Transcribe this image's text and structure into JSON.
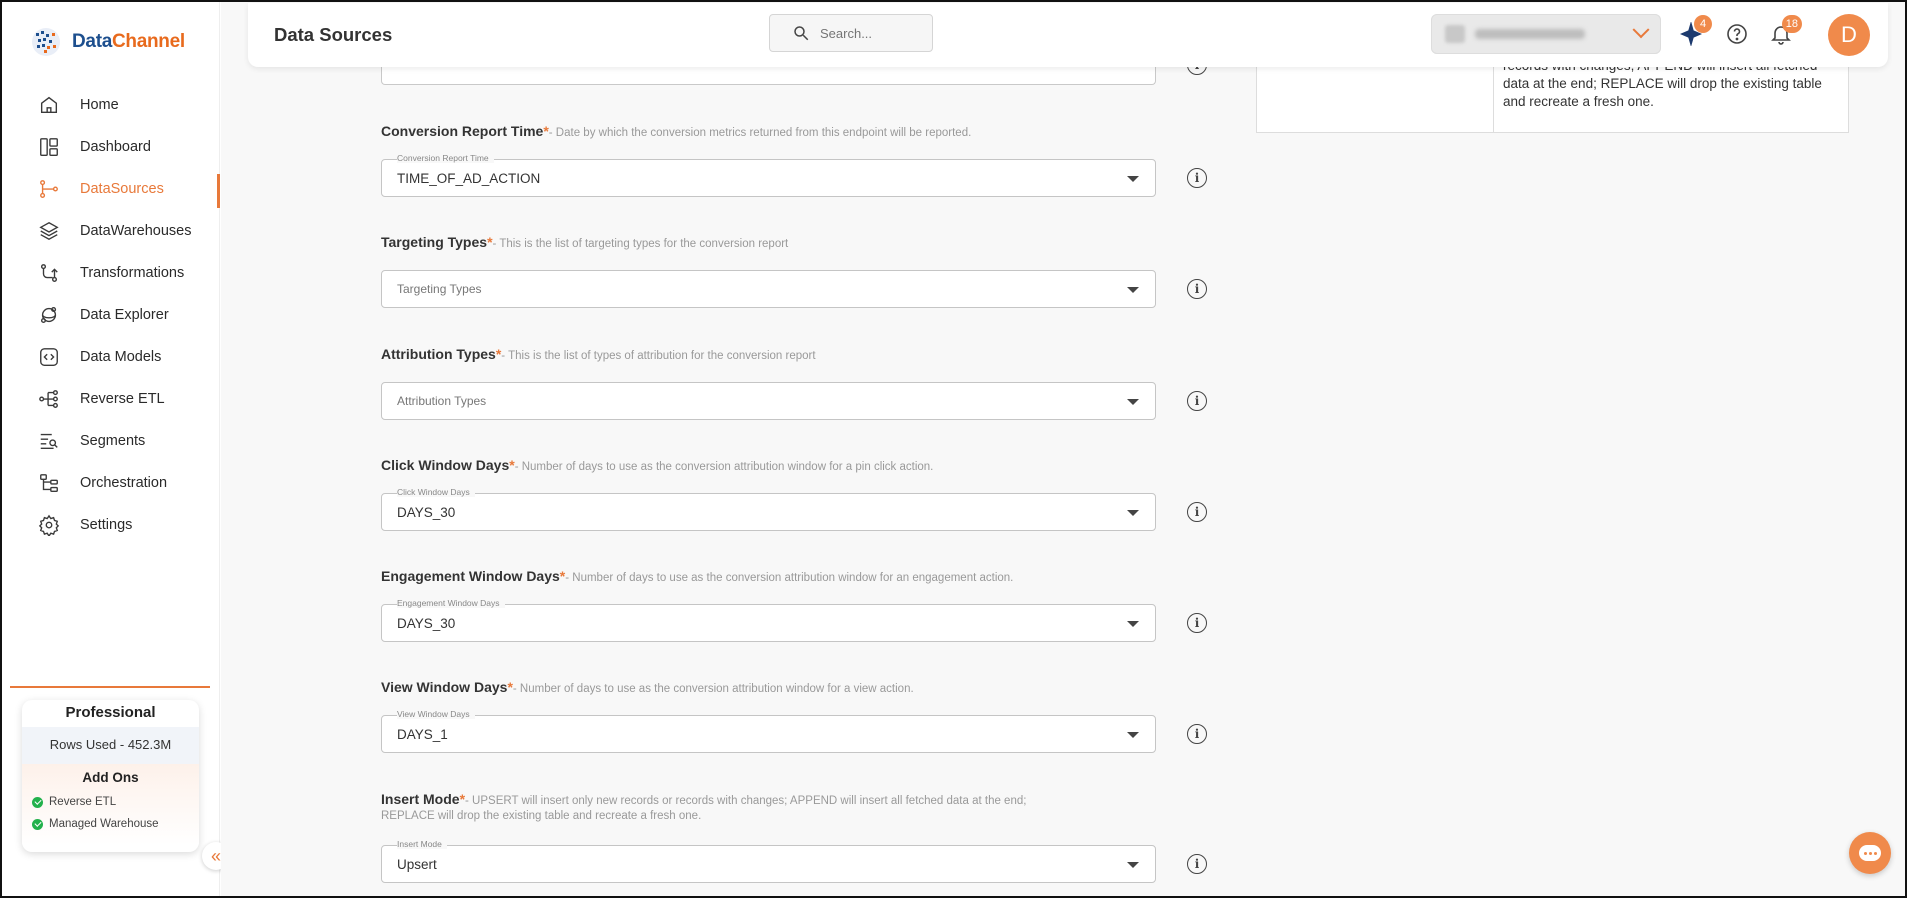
{
  "brand": {
    "name_part1": "Data",
    "name_part2": "Channel"
  },
  "sidebar": {
    "items": [
      {
        "label": "Home",
        "icon": "home-icon"
      },
      {
        "label": "Dashboard",
        "icon": "dashboard-icon"
      },
      {
        "label": "DataSources",
        "icon": "datasources-icon",
        "active": true
      },
      {
        "label": "DataWarehouses",
        "icon": "layers-icon"
      },
      {
        "label": "Transformations",
        "icon": "transform-icon"
      },
      {
        "label": "Data Explorer",
        "icon": "explorer-icon"
      },
      {
        "label": "Data Models",
        "icon": "models-icon"
      },
      {
        "label": "Reverse ETL",
        "icon": "reverse-etl-icon"
      },
      {
        "label": "Segments",
        "icon": "segments-icon"
      },
      {
        "label": "Orchestration",
        "icon": "orchestration-icon"
      },
      {
        "label": "Settings",
        "icon": "gear-icon"
      }
    ],
    "plan": {
      "name": "Professional",
      "rows_used": "Rows Used - 452.3M",
      "addons_title": "Add Ons",
      "addons": [
        "Reverse ETL",
        "Managed Warehouse"
      ]
    }
  },
  "header": {
    "title": "Data Sources",
    "search_placeholder": "Search...",
    "sparkle_badge": "4",
    "notifications_badge": "18",
    "avatar_initial": "D"
  },
  "form": {
    "fields": [
      {
        "label": "Conversion Report Time",
        "description": "- Date by which the conversion metrics returned from this endpoint will be reported.",
        "float_label": "Conversion Report Time",
        "value": "TIME_OF_AD_ACTION"
      },
      {
        "label": "Targeting Types",
        "description": "- This is the list of targeting types for the conversion report",
        "placeholder": "Targeting Types"
      },
      {
        "label": "Attribution Types",
        "description": "- This is the list of types of attribution for the conversion report",
        "placeholder": "Attribution Types"
      },
      {
        "label": "Click Window Days",
        "description": "- Number of days to use as the conversion attribution window for a pin click action.",
        "float_label": "Click Window Days",
        "value": "DAYS_30"
      },
      {
        "label": "Engagement Window Days",
        "description": "- Number of days to use as the conversion attribution window for an engagement action.",
        "float_label": "Engagement Window Days",
        "value": "DAYS_30"
      },
      {
        "label": "View Window Days",
        "description": "- Number of days to use as the conversion attribution window for a view action.",
        "float_label": "View Window Days",
        "value": "DAYS_1"
      },
      {
        "label": "Insert Mode",
        "description": "- UPSERT will insert only new records or records with changes; APPEND will insert all fetched data at the end;",
        "description_line2": "REPLACE will drop the existing table and recreate a fresh one.",
        "float_label": "Insert Mode",
        "value": "Upsert"
      }
    ]
  },
  "side_table": {
    "text": "records with changes; APPEND will insert all fetched data at the end; REPLACE will drop the existing table and recreate a fresh one."
  }
}
